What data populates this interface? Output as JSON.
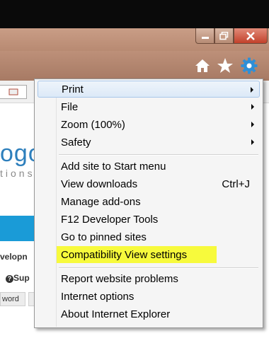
{
  "window": {
    "minimize_icon": "minimize-icon",
    "maximize_icon": "maximize-icon",
    "close_icon": "close-icon"
  },
  "toolbar": {
    "home_icon": "home-icon",
    "favorites_icon": "star-icon",
    "tools_icon": "gear-icon"
  },
  "page": {
    "logo_text": "ogo",
    "logo_sub": "tions",
    "dev_text": "velopn",
    "sup_text": "Sup",
    "word_tag": "word"
  },
  "menu": {
    "items": [
      {
        "label": "Print",
        "submenu": true
      },
      {
        "label": "File",
        "submenu": true
      },
      {
        "label": "Zoom (100%)",
        "submenu": true
      },
      {
        "label": "Safety",
        "submenu": true
      },
      {
        "label": "Add site to Start menu"
      },
      {
        "label": "View downloads",
        "shortcut": "Ctrl+J"
      },
      {
        "label": "Manage add-ons"
      },
      {
        "label": "F12 Developer Tools"
      },
      {
        "label": "Go to pinned sites"
      },
      {
        "label": "Compatibility View settings",
        "highlighted": true
      },
      {
        "label": "Report website problems"
      },
      {
        "label": "Internet options"
      },
      {
        "label": "About Internet Explorer"
      }
    ]
  },
  "colors": {
    "highlight": "#f7fa3c",
    "titlebar": "#c99d86",
    "close_button": "#c2412b",
    "accent_blue": "#1a9bd7"
  }
}
